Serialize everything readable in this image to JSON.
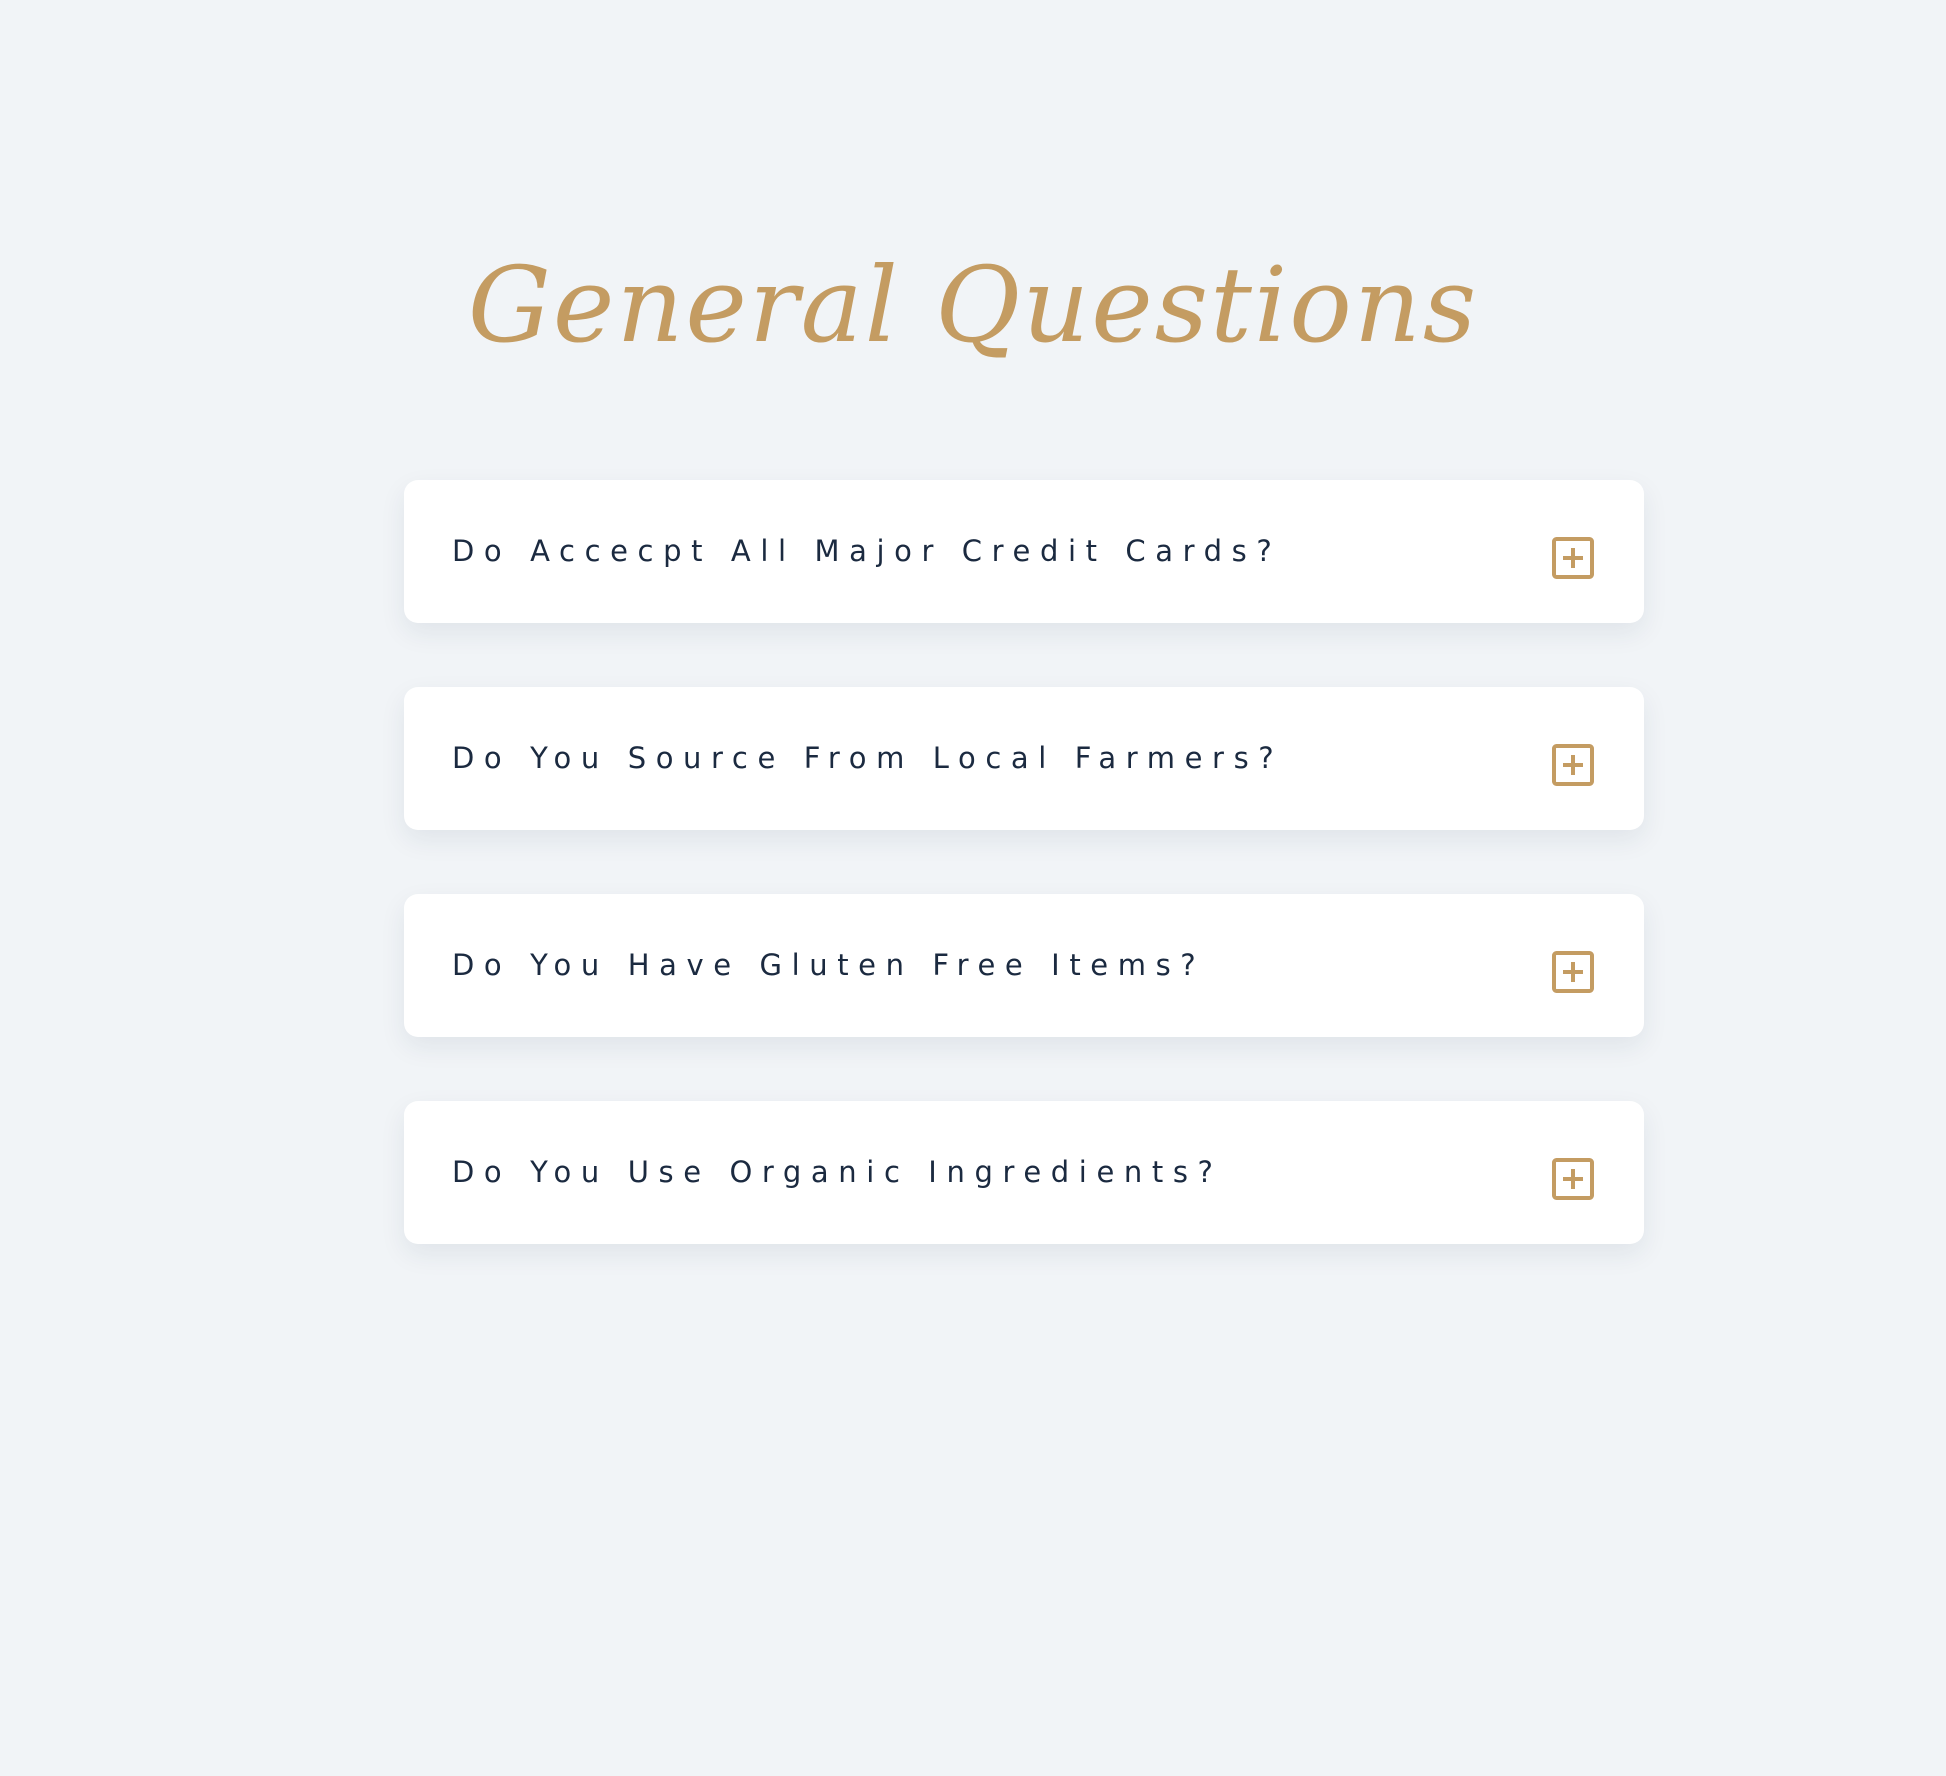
{
  "page": {
    "title": "General Questions"
  },
  "colors": {
    "background": "#f1f4f7",
    "accent": "#c49c62",
    "question_text": "#1b2a40",
    "card": "#ffffff"
  },
  "faq": {
    "items": [
      {
        "question": "Do Accecpt All Major Credit Cards?",
        "icon": "plus-square-icon",
        "expanded": false
      },
      {
        "question": "Do You Source From Local Farmers?",
        "icon": "plus-square-icon",
        "expanded": false
      },
      {
        "question": "Do You Have Gluten Free Items?",
        "icon": "plus-square-icon",
        "expanded": false
      },
      {
        "question": "Do You Use Organic Ingredients?",
        "icon": "plus-square-icon",
        "expanded": false
      }
    ]
  }
}
